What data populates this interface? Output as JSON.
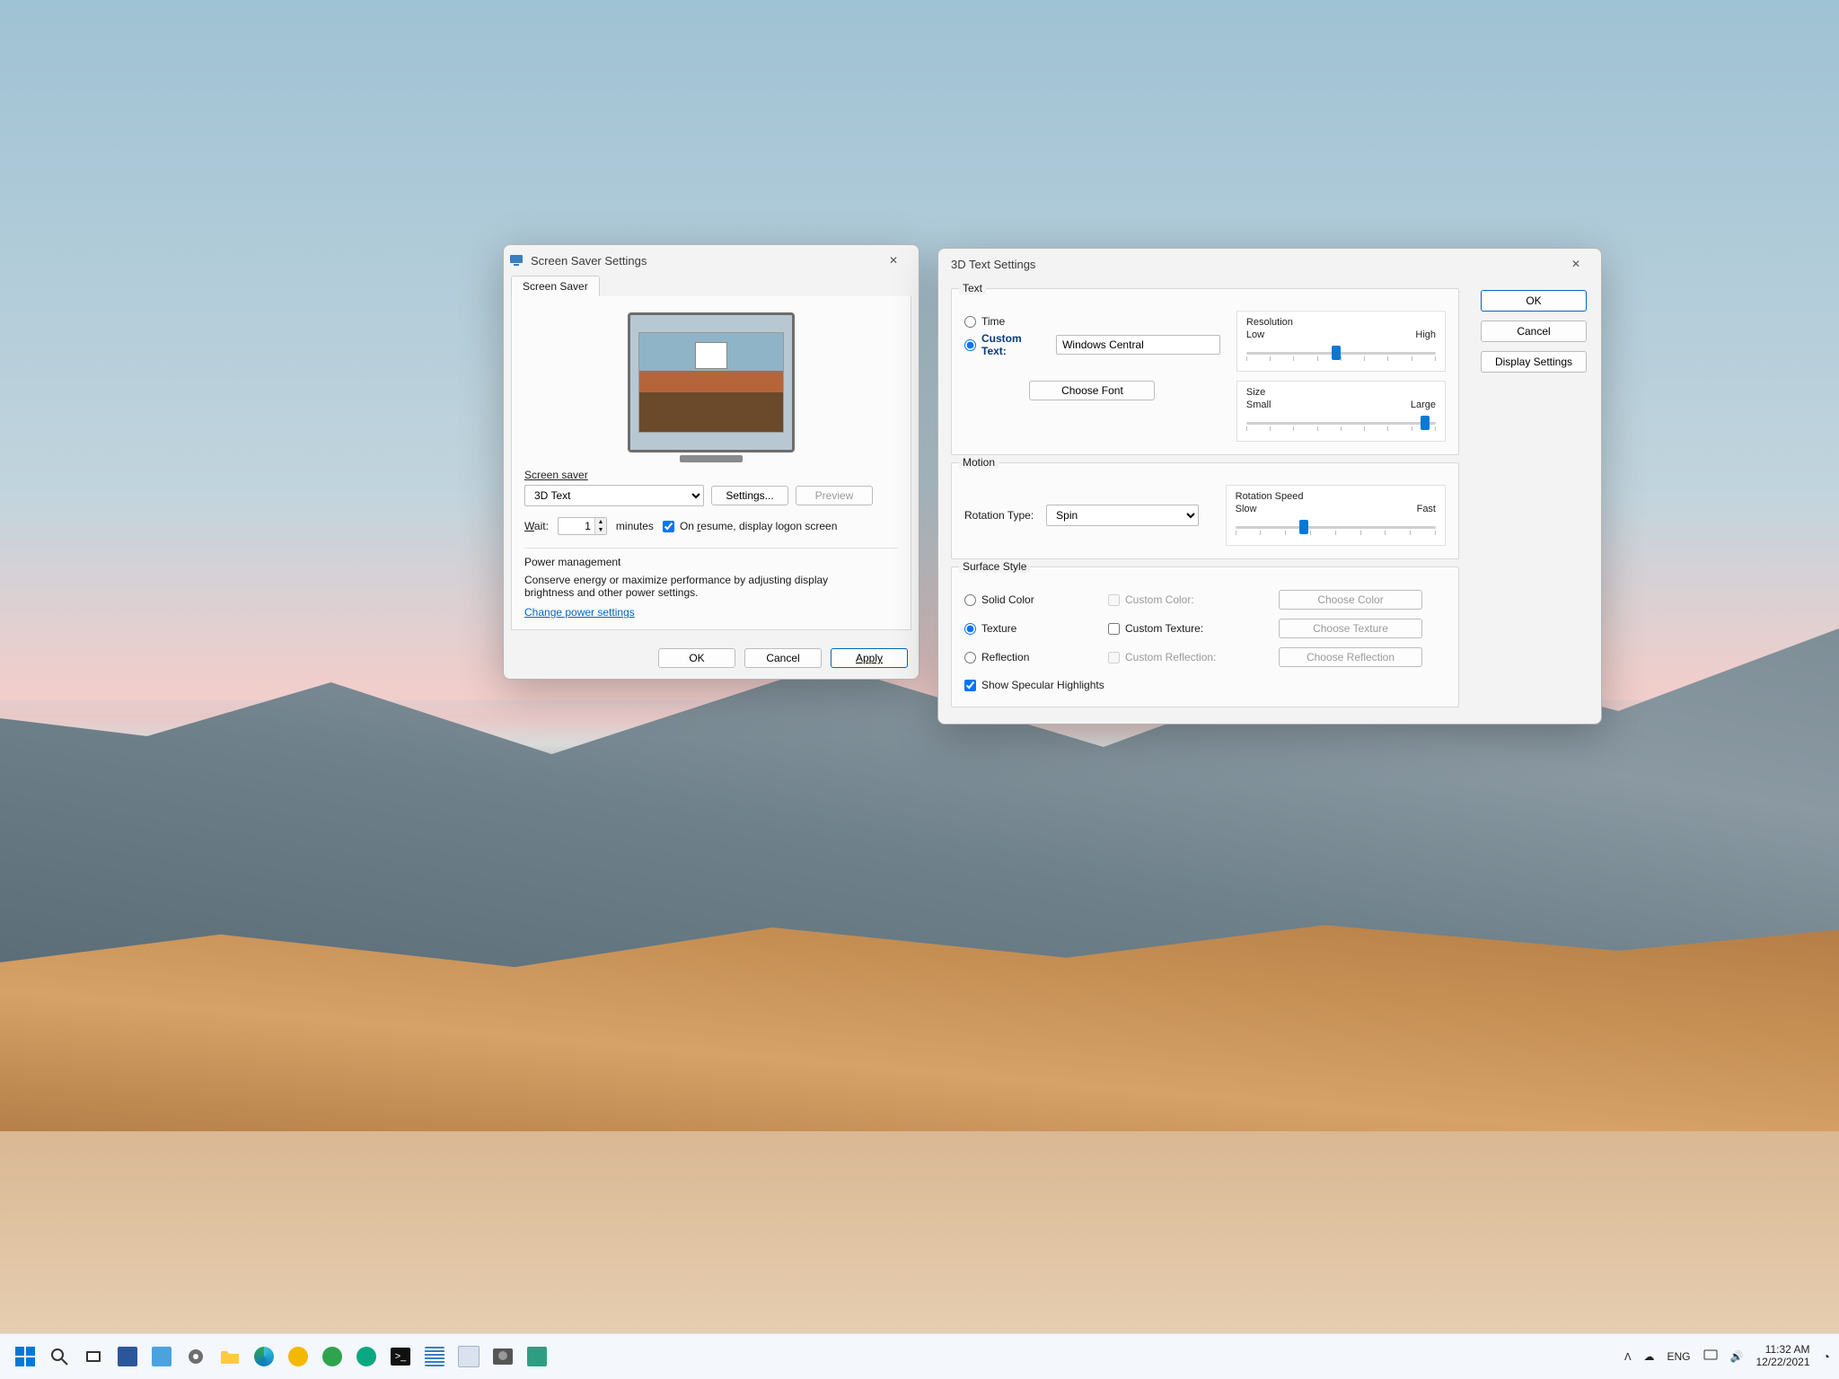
{
  "screensaver": {
    "title": "Screen Saver Settings",
    "tab": "Screen Saver",
    "saver_label": "Screen saver",
    "saver_value": "3D Text",
    "settings_btn": "Settings...",
    "preview_btn": "Preview",
    "wait_label": "Wait:",
    "wait_value": "1",
    "wait_unit": "minutes",
    "resume_label": "On resume, display logon screen",
    "resume_checked": true,
    "pm_header": "Power management",
    "pm_text": "Conserve energy or maximize performance by adjusting display brightness and other power settings.",
    "pm_link": "Change power settings",
    "ok": "OK",
    "cancel": "Cancel",
    "apply": "Apply"
  },
  "td": {
    "title": "3D Text Settings",
    "ok": "OK",
    "cancel": "Cancel",
    "display_settings": "Display Settings",
    "text_group": "Text",
    "time_label": "Time",
    "custom_label": "Custom Text:",
    "custom_value": "Windows Central",
    "choose_font": "Choose Font",
    "resolution_label": "Resolution",
    "low": "Low",
    "high": "High",
    "size_label": "Size",
    "small": "Small",
    "large": "Large",
    "motion_group": "Motion",
    "rotation_type_label": "Rotation Type:",
    "rotation_value": "Spin",
    "rotation_speed": "Rotation Speed",
    "slow": "Slow",
    "fast": "Fast",
    "surface_group": "Surface Style",
    "solid": "Solid Color",
    "texture": "Texture",
    "reflection": "Reflection",
    "custom_color": "Custom Color:",
    "custom_texture": "Custom Texture:",
    "custom_reflection": "Custom Reflection:",
    "choose_color": "Choose Color",
    "choose_texture": "Choose Texture",
    "choose_reflection": "Choose Reflection",
    "specular": "Show Specular Highlights"
  },
  "tray": {
    "lang": "ENG",
    "time": "11:32 AM",
    "date": "12/22/2021"
  }
}
